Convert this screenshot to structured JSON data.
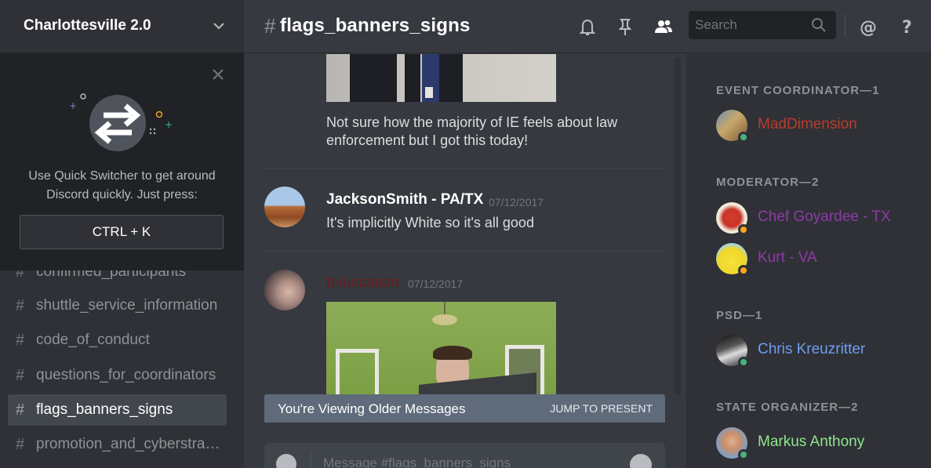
{
  "server": {
    "name": "Charlottesville 2.0"
  },
  "quick_switcher": {
    "text_line1": "Use Quick Switcher to get around",
    "text_line2": "Discord quickly. Just press:",
    "shortcut": "CTRL + K"
  },
  "channels": [
    {
      "name": "confirmed_participants",
      "active": false
    },
    {
      "name": "shuttle_service_information",
      "active": false
    },
    {
      "name": "code_of_conduct",
      "active": false
    },
    {
      "name": "questions_for_coordinators",
      "active": false
    },
    {
      "name": "flags_banners_signs",
      "active": true
    },
    {
      "name": "promotion_and_cyberstrategy",
      "active": false
    }
  ],
  "channel_hash": "#",
  "header": {
    "hash": "#",
    "channel_name": "flags_banners_signs",
    "search_placeholder": "Search"
  },
  "messages": [
    {
      "text_line1": "Not sure how the majority of IE feels about law",
      "text_line2": "enforcement but I got this today!"
    },
    {
      "author": "JacksonSmith - PA/TX",
      "author_color": "#ffffff",
      "timestamp": "07/12/2017",
      "text": "It's implicitly White so it's all good"
    },
    {
      "author": "b-luccason",
      "author_color": "#6e1b1b",
      "timestamp": "07/12/2017"
    }
  ],
  "older_banner": {
    "text": "You're Viewing Older Messages",
    "jump": "JUMP TO PRESENT"
  },
  "composer": {
    "placeholder": "Message #flags_banners_signs"
  },
  "member_groups": [
    {
      "role": "EVENT COORDINATOR—1",
      "members": [
        {
          "name": "MadDimension",
          "color": "#b93c2d",
          "status": "online"
        }
      ]
    },
    {
      "role": "MODERATOR—2",
      "members": [
        {
          "name": "Chef Goyardee - TX",
          "color": "#8f3aa8",
          "status": "idle"
        },
        {
          "name": "Kurt - VA",
          "color": "#8f3aa8",
          "status": "idle"
        }
      ]
    },
    {
      "role": "PSD—1",
      "members": [
        {
          "name": "Chris Kreuzritter",
          "color": "#6e9ef1",
          "status": "online"
        }
      ]
    },
    {
      "role": "STATE ORGANIZER—2",
      "members": [
        {
          "name": "Markus Anthony",
          "color": "#8fe58f",
          "status": "online"
        }
      ]
    }
  ],
  "colors": {
    "online": "#43b581",
    "idle": "#faa61a"
  }
}
